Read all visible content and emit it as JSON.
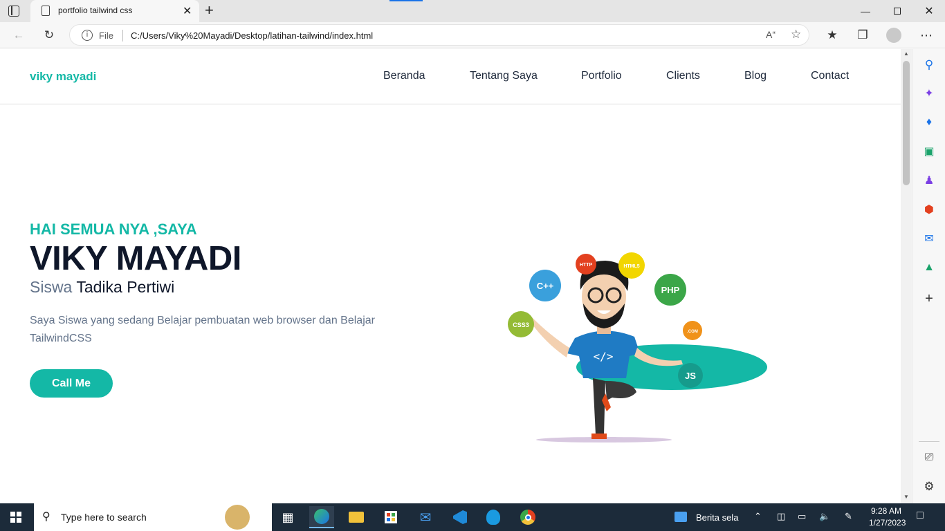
{
  "browser": {
    "tab_title": "portfolio tailwind css",
    "address_scheme": "File",
    "address_url": "C:/Users/Viky%20Mayadi/Desktop/latihan-tailwind/index.html"
  },
  "site": {
    "brand": "viky mayadi",
    "nav": [
      {
        "label": "Beranda"
      },
      {
        "label": "Tentang Saya"
      },
      {
        "label": "Portfolio"
      },
      {
        "label": "Clients"
      },
      {
        "label": "Blog"
      },
      {
        "label": "Contact"
      }
    ],
    "hero": {
      "greeting": "HAI SEMUA NYA ,SAYA",
      "name": "VIKY MAYADI",
      "role_prefix": "Siswa",
      "role_rest": "Tadika Pertiwi",
      "description": "Saya Siswa yang sedang Belajar pembuatan web browser dan Belajar TailwindCSS",
      "cta_label": "Call Me"
    },
    "illustration_bubbles": [
      {
        "label": "HTTP",
        "color": "#e3401f"
      },
      {
        "label": "HTML5",
        "color": "#f2d600"
      },
      {
        "label": "C++",
        "color": "#3aa0dc"
      },
      {
        "label": "PHP",
        "color": "#3ba648"
      },
      {
        "label": "CSS3",
        "color": "#94bb35"
      },
      {
        "label": ".COM",
        "color": "#f0921a"
      },
      {
        "label": "JS",
        "color": "#169b8c"
      }
    ]
  },
  "taskbar": {
    "search_placeholder": "Type here to search",
    "news_label": "Berita sela",
    "time": "9:28 AM",
    "date": "1/27/2023"
  },
  "colors": {
    "accent": "#14b8a6",
    "heading": "#0f172a",
    "muted": "#64748b"
  }
}
